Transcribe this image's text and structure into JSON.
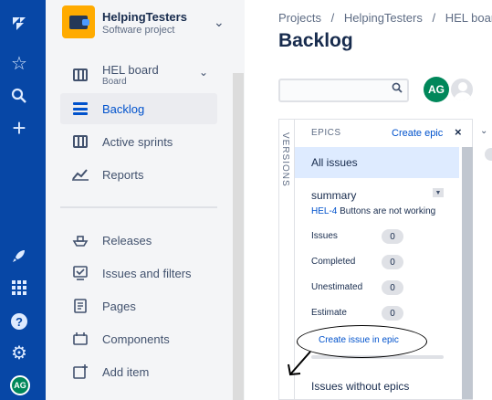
{
  "global_nav": {
    "icons": [
      "jira-logo-icon",
      "star-icon",
      "search-icon",
      "plus-icon",
      "rocket-icon",
      "apps-grid-icon",
      "help-icon",
      "settings-icon"
    ],
    "avatar_initials": "AG"
  },
  "project": {
    "name": "HelpingTesters",
    "type": "Software project"
  },
  "sidebar": {
    "board": {
      "label": "HEL board",
      "sublabel": "Board"
    },
    "items": [
      {
        "label": "Backlog",
        "active": true
      },
      {
        "label": "Active sprints"
      },
      {
        "label": "Reports"
      }
    ],
    "items2": [
      {
        "label": "Releases"
      },
      {
        "label": "Issues and filters"
      },
      {
        "label": "Pages"
      },
      {
        "label": "Components"
      },
      {
        "label": "Add item"
      }
    ]
  },
  "breadcrumbs": [
    "Projects",
    "/",
    "HelpingTesters",
    "/",
    "HEL board"
  ],
  "page_title": "Backlog",
  "search": {
    "placeholder": ""
  },
  "avatars": {
    "user_initials": "AG"
  },
  "versions_tab": "VERSIONS",
  "epics": {
    "header": "EPICS",
    "create_label": "Create epic",
    "close": "×",
    "all_issues": "All issues",
    "epic": {
      "name": "summary",
      "issue_key": "HEL-4",
      "issue_summary": "Buttons are not working",
      "stats": [
        {
          "label": "Issues",
          "value": "0"
        },
        {
          "label": "Completed",
          "value": "0"
        },
        {
          "label": "Unestimated",
          "value": "0"
        },
        {
          "label": "Estimate",
          "value": "0"
        }
      ],
      "create_issue_label": "Create issue in epic"
    },
    "issues_without_epics": "Issues without epics"
  },
  "colors": {
    "global_nav": "#0747a6",
    "link": "#0052cc",
    "selected": "#deebff",
    "avatar": "#00875a",
    "project_avatar": "#ffab00"
  }
}
